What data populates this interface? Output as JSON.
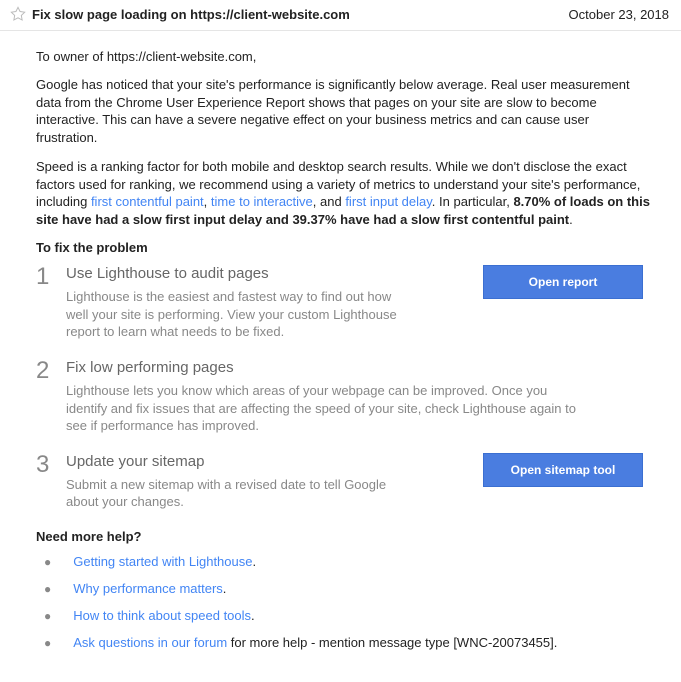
{
  "header": {
    "title": "Fix slow page loading on https://client-website.com",
    "date": "October 23, 2018"
  },
  "greeting": "To owner of https://client-website.com,",
  "intro_para": "Google has noticed that your site's performance is significantly below average. Real user measurement data from the Chrome User Experience Report shows that pages on your site are slow to become interactive. This can have a severe negative effect on your business metrics and can cause user frustration.",
  "speed_para": {
    "part1": "Speed is a ranking factor for both mobile and desktop search results. While we don't disclose the exact factors used for ranking, we recommend using a variety of metrics to understand your site's performance, including ",
    "link1": "first contentful paint",
    "sep1": ", ",
    "link2": "time to interactive",
    "sep2": ", and ",
    "link3": "first input delay",
    "tail": ". In particular, ",
    "bold": "8.70% of loads on this site have had a slow first input delay and 39.37% have had a slow first contentful paint",
    "period": "."
  },
  "fix_heading": "To fix the problem",
  "steps": [
    {
      "num": "1",
      "title": "Use Lighthouse to audit pages",
      "desc": "Lighthouse is the easiest and fastest way to find out how well your site is performing. View your custom Lighthouse report to learn what needs to be fixed.",
      "button": "Open report"
    },
    {
      "num": "2",
      "title": "Fix low performing pages",
      "desc": "Lighthouse lets you know which areas of your webpage can be improved. Once you identify and fix issues that are affecting the speed of your site, check Lighthouse again to see if performance has improved."
    },
    {
      "num": "3",
      "title": "Update your sitemap",
      "desc": "Submit a new sitemap with a revised date to tell Google about your changes.",
      "button": "Open sitemap tool"
    }
  ],
  "help_heading": "Need more help?",
  "help_links": [
    {
      "text": "Getting started with Lighthouse",
      "suffix": "."
    },
    {
      "text": "Why performance matters",
      "suffix": "."
    },
    {
      "text": "How to think about speed tools",
      "suffix": "."
    },
    {
      "text": "Ask questions in our forum",
      "suffix": " for more help - mention message type [WNC-20073455]."
    }
  ]
}
